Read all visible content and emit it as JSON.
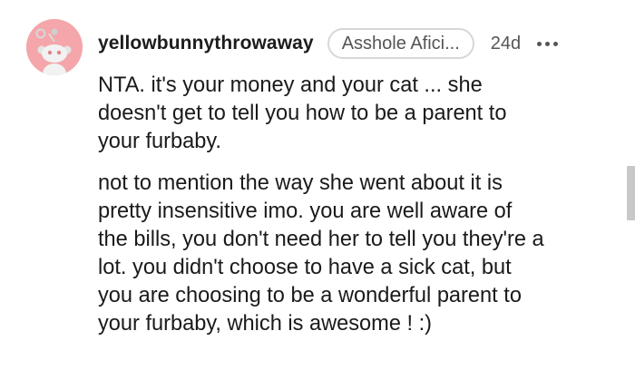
{
  "comment": {
    "username": "yellowbunnythrowaway",
    "flair": "Asshole Afici...",
    "time": "24d",
    "paragraphs": [
      "NTA. it's your money and your cat ... she\ndoesn't get to tell you how to be a parent to\nyour furbaby.",
      "not to mention the way she went about it is\npretty insensitive imo. you are well aware of\nthe bills, you don't need her to tell you they're a\nlot. you didn't choose to have a sick cat, but\nyou are choosing to be a wonderful parent to\nyour furbaby, which is awesome ! :)"
    ]
  },
  "colors": {
    "avatar_bg": "#f4a6ab",
    "text": "#1a1a1b",
    "meta": "#555555"
  }
}
